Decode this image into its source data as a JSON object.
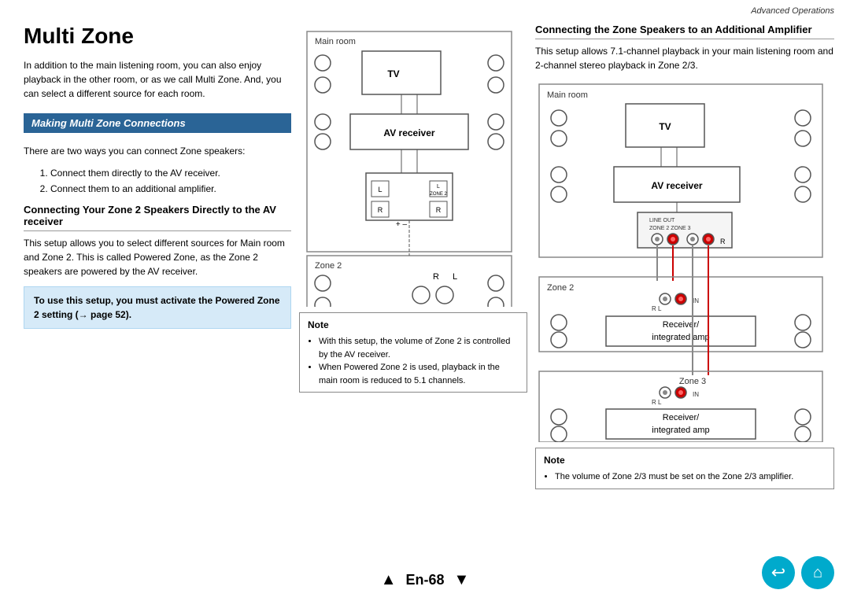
{
  "header": {
    "section": "Advanced Operations"
  },
  "page": {
    "title": "Multi Zone",
    "intro": "In addition to the main listening room, you can also enjoy playback in the other room, or as we call Multi Zone. And, you can select a different source for each room.",
    "making_connections_label": "Making Multi Zone Connections",
    "ways_intro": "There are two ways you can connect Zone speakers:",
    "ways": [
      "Connect them directly to the AV receiver.",
      "Connect them to an additional amplifier."
    ],
    "subsection1_title": "Connecting Your Zone 2 Speakers Directly to the AV receiver",
    "subsection1_body": "This setup allows you to select different sources for Main room and Zone 2. This is called Powered Zone, as the Zone 2 speakers are powered by the AV receiver.",
    "highlight": {
      "text": "To use this setup, you must activate the Powered Zone 2 setting (→ page 52)."
    },
    "note1_title": "Note",
    "note1_bullets": [
      "With this setup, the volume of Zone 2 is controlled by the AV receiver.",
      "When Powered Zone 2 is used, playback in the main room is reduced to 5.1 channels."
    ],
    "subsection2_title": "Connecting the Zone Speakers to an Additional Amplifier",
    "subsection2_body": "This setup allows 7.1-channel playback in your main listening room and 2-channel stereo playback in Zone 2/3.",
    "note2_title": "Note",
    "note2_bullets": [
      "The volume of Zone 2/3 must be set on the Zone 2/3 amplifier."
    ],
    "footer_page": "En-68",
    "labels": {
      "main_room": "Main room",
      "tv": "TV",
      "av_receiver": "AV receiver",
      "zone2": "Zone 2",
      "zone3": "Zone 3",
      "receiver_integrated_amp": "Receiver/\nintegrated amp",
      "r": "R",
      "l": "L",
      "line_out": "LINE OUT",
      "zone2_label": "ZONE 2",
      "zone3_label": "ZONE 3",
      "plus": "+",
      "minus": "–"
    }
  }
}
